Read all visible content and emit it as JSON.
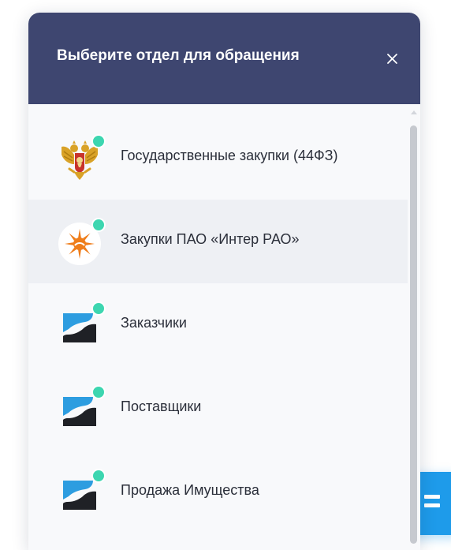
{
  "dialog": {
    "title": "Выберите отдел для обращения",
    "close_icon": "close-icon",
    "colors": {
      "header_bg": "#3e4670",
      "status_online": "#3dd6b0",
      "chat_button": "#1e9bea"
    }
  },
  "departments": [
    {
      "label": "Государственные закупки (44ФЗ)",
      "icon": "russian-coat-of-arms-icon",
      "status": "online",
      "active": false
    },
    {
      "label": "Закупки ПАО «Интер РАО»",
      "icon": "inter-rao-logo-icon",
      "status": "online",
      "active": true
    },
    {
      "label": "Заказчики",
      "icon": "platform-logo-icon",
      "status": "online",
      "active": false
    },
    {
      "label": "Поставщики",
      "icon": "platform-logo-icon",
      "status": "online",
      "active": false
    },
    {
      "label": "Продажа Имущества",
      "icon": "platform-logo-icon",
      "status": "online",
      "active": false
    }
  ],
  "chat_button": {
    "icon": "chat-lines-icon"
  }
}
